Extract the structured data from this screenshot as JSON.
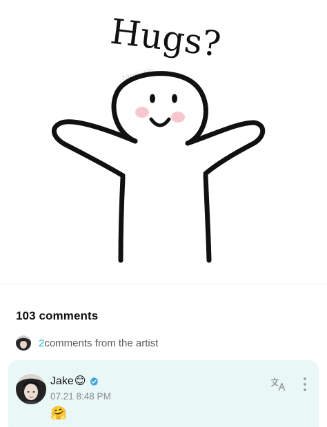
{
  "post_image": {
    "title_text": "Hugs?",
    "watermark_text": "tanserin"
  },
  "comments": {
    "count_label": "103 comments",
    "artist_count": "2",
    "artist_label": "comments from the artist"
  },
  "comment": {
    "author": "Jake",
    "author_emoji": "😊",
    "timestamp": "07.21 8:48 PM",
    "body": "🤗"
  },
  "colors": {
    "accent": "#23b5c8",
    "card_background": "#e9f8f7",
    "verified_badge": "#3fa3d8",
    "blush": "#f7c7cf"
  },
  "icons": {
    "translate": "translate-icon",
    "more": "more-vertical-icon",
    "verified": "verified-badge-icon"
  }
}
